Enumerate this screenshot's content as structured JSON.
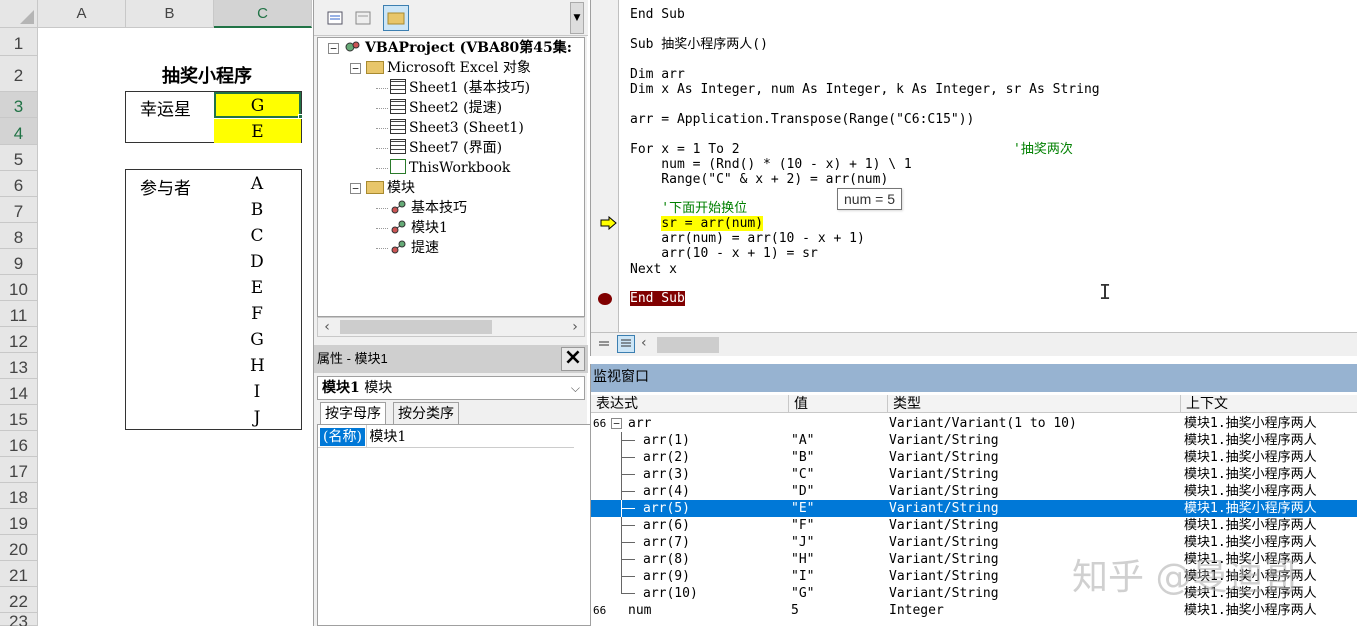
{
  "excel": {
    "columns": [
      "A",
      "B",
      "C"
    ],
    "rows": [
      "1",
      "2",
      "3",
      "4",
      "5",
      "6",
      "7",
      "8",
      "9",
      "10",
      "11",
      "12",
      "13",
      "14",
      "15",
      "16",
      "17",
      "18",
      "19",
      "20",
      "21",
      "22",
      "23"
    ],
    "title": "抽奖小程序",
    "winner_label": "幸运星",
    "winners": [
      "G",
      "E"
    ],
    "participant_label": "参与者",
    "participants": [
      "A",
      "B",
      "C",
      "D",
      "E",
      "F",
      "G",
      "H",
      "I",
      "J"
    ],
    "highlight_color": "#ffff00"
  },
  "project": {
    "root": "VBAProject (VBA80第45集:",
    "excel_objects": "Microsoft Excel 对象",
    "sheets": [
      "Sheet1 (基本技巧)",
      "Sheet2 (提速)",
      "Sheet3 (Sheet1)",
      "Sheet7 (界面)",
      "ThisWorkbook"
    ],
    "modules_folder": "模块",
    "modules": [
      "基本技巧",
      "模块1",
      "提速"
    ]
  },
  "properties": {
    "title": "属性 - 模块1",
    "combo_name": "模块1",
    "combo_type": "模块",
    "tab_alpha": "按字母序",
    "tab_category": "按分类序",
    "key": "(名称)",
    "value": "模块1"
  },
  "code": {
    "lines": [
      "End Sub",
      "Sub 抽奖小程序两人()",
      "Dim arr",
      "Dim x As Integer, num As Integer, k As Integer, sr As String",
      "arr = Application.Transpose(Range(\"C6:C15\"))",
      "For x = 1 To 2",
      "'抽奖两次",
      "    num = (Rnd() * (10 - x) + 1) \\ 1",
      "    Range(\"C\" & x + 2) = arr(num)",
      "    '下面开始换位",
      "    sr = arr(num)",
      "    arr(num) = arr(10 - x + 1)",
      "    arr(10 - x + 1) = sr",
      "Next x",
      "End Sub"
    ],
    "tooltip": "num = 5"
  },
  "watch": {
    "title": "监视窗口",
    "headers": [
      "表达式",
      "值",
      "类型",
      "上下文"
    ],
    "rows": [
      {
        "expr": "arr",
        "value": "",
        "type": "Variant/Variant(1 to 10)",
        "context": "模块1.抽奖小程序两人"
      },
      {
        "expr": "arr(1)",
        "value": "\"A\"",
        "type": "Variant/String",
        "context": "模块1.抽奖小程序两人"
      },
      {
        "expr": "arr(2)",
        "value": "\"B\"",
        "type": "Variant/String",
        "context": "模块1.抽奖小程序两人"
      },
      {
        "expr": "arr(3)",
        "value": "\"C\"",
        "type": "Variant/String",
        "context": "模块1.抽奖小程序两人"
      },
      {
        "expr": "arr(4)",
        "value": "\"D\"",
        "type": "Variant/String",
        "context": "模块1.抽奖小程序两人"
      },
      {
        "expr": "arr(5)",
        "value": "\"E\"",
        "type": "Variant/String",
        "context": "模块1.抽奖小程序两人"
      },
      {
        "expr": "arr(6)",
        "value": "\"F\"",
        "type": "Variant/String",
        "context": "模块1.抽奖小程序两人"
      },
      {
        "expr": "arr(7)",
        "value": "\"J\"",
        "type": "Variant/String",
        "context": "模块1.抽奖小程序两人"
      },
      {
        "expr": "arr(8)",
        "value": "\"H\"",
        "type": "Variant/String",
        "context": "模块1.抽奖小程序两人"
      },
      {
        "expr": "arr(9)",
        "value": "\"I\"",
        "type": "Variant/String",
        "context": "模块1.抽奖小程序两人"
      },
      {
        "expr": "arr(10)",
        "value": "\"G\"",
        "type": "Variant/String",
        "context": "模块1.抽奖小程序两人"
      },
      {
        "expr": "num",
        "value": "5",
        "type": "Integer",
        "context": "模块1.抽奖小程序两人"
      }
    ]
  },
  "watermark": "知乎 @曼迪哥"
}
